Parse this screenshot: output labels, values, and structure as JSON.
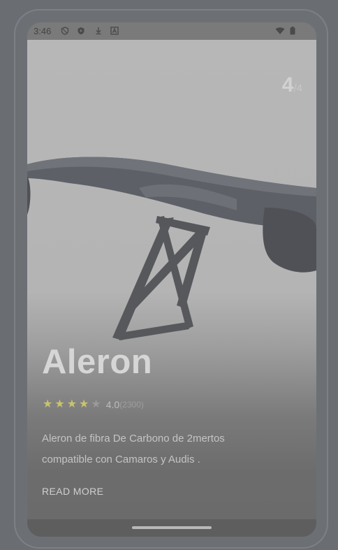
{
  "status_bar": {
    "time": "3:46",
    "left_icons": [
      "shield-icon",
      "shield-play-icon",
      "download-icon",
      "a-box-icon"
    ],
    "right_icons": [
      "wifi-icon",
      "battery-icon"
    ]
  },
  "carousel": {
    "current": "4",
    "total": "/4"
  },
  "product": {
    "title": "Aleron",
    "rating": 4.0,
    "rating_value": "4.0",
    "rating_count": "(2300)",
    "stars_filled": 4,
    "stars_total": 5,
    "description": "Aleron de fibra De Carbono de 2mertos compatible con Camaros y Audis .",
    "read_more": "READ MORE"
  },
  "colors": {
    "star_on": "#c9c36b",
    "star_off": "#9a9a9a",
    "title": "#d6d6d6"
  }
}
